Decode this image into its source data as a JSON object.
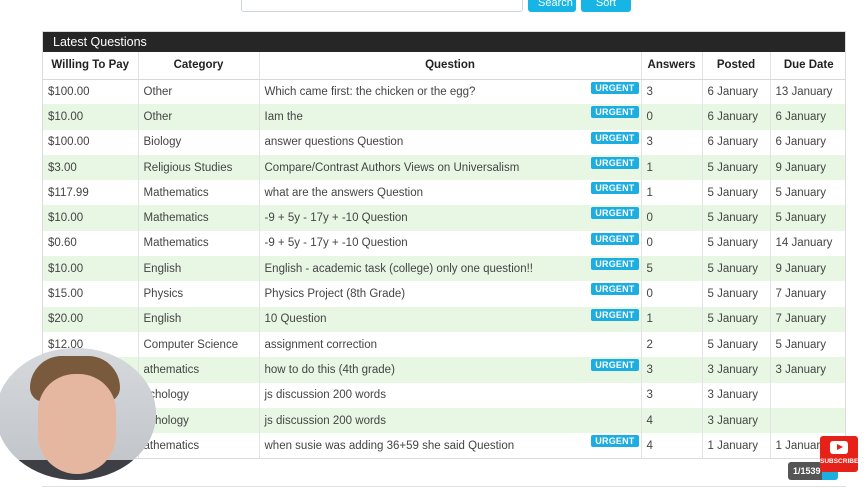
{
  "toolbar": {
    "search_label": "Search",
    "sort_label": "Sort by"
  },
  "panel": {
    "title": "Latest Questions"
  },
  "columns": [
    "Willing To Pay",
    "Category",
    "Question",
    "Answers",
    "Posted",
    "Due Date"
  ],
  "badge_text": "URGENT",
  "rows": [
    {
      "pay": "$100.00",
      "category": "Other",
      "question": "Which came first: the chicken or the egg?",
      "urgent": true,
      "answers": "3",
      "posted": "6 January",
      "due": "13 January"
    },
    {
      "pay": "$10.00",
      "category": "Other",
      "question": "Iam the",
      "urgent": true,
      "answers": "0",
      "posted": "6 January",
      "due": "6 January"
    },
    {
      "pay": "$100.00",
      "category": "Biology",
      "question": "answer questions Question",
      "urgent": true,
      "answers": "3",
      "posted": "6 January",
      "due": "6 January"
    },
    {
      "pay": "$3.00",
      "category": "Religious Studies",
      "question": "Compare/Contrast Authors Views on Universalism",
      "urgent": true,
      "answers": "1",
      "posted": "5 January",
      "due": "9 January"
    },
    {
      "pay": "$117.99",
      "category": "Mathematics",
      "question": "what are the answers Question",
      "urgent": true,
      "answers": "1",
      "posted": "5 January",
      "due": "5 January"
    },
    {
      "pay": "$10.00",
      "category": "Mathematics",
      "question": "-9 + 5y - 17y + -10 Question",
      "urgent": true,
      "answers": "0",
      "posted": "5 January",
      "due": "5 January"
    },
    {
      "pay": "$0.60",
      "category": "Mathematics",
      "question": "-9 + 5y - 17y + -10 Question",
      "urgent": true,
      "answers": "0",
      "posted": "5 January",
      "due": "14 January"
    },
    {
      "pay": "$10.00",
      "category": "English",
      "question": "English - academic task (college) only one question!!",
      "urgent": true,
      "answers": "5",
      "posted": "5 January",
      "due": "9 January"
    },
    {
      "pay": "$15.00",
      "category": "Physics",
      "question": "Physics Project (8th Grade)",
      "urgent": true,
      "answers": "0",
      "posted": "5 January",
      "due": "7 January"
    },
    {
      "pay": "$20.00",
      "category": "English",
      "question": "10 Question",
      "urgent": true,
      "answers": "1",
      "posted": "5 January",
      "due": "7 January"
    },
    {
      "pay": "$12.00",
      "category": "Computer Science",
      "question": "assignment correction",
      "urgent": false,
      "answers": "2",
      "posted": "5 January",
      "due": "5 January"
    },
    {
      "pay": "",
      "category": "athematics",
      "question": "how to do this (4th grade)",
      "urgent": true,
      "answers": "3",
      "posted": "3 January",
      "due": "3 January"
    },
    {
      "pay": "",
      "category": "ychology",
      "question": "js discussion 200 words",
      "urgent": false,
      "answers": "3",
      "posted": "3 January",
      "due": ""
    },
    {
      "pay": "",
      "category": "ychology",
      "question": "js discussion 200 words",
      "urgent": false,
      "answers": "4",
      "posted": "3 January",
      "due": ""
    },
    {
      "pay": "",
      "category": "athematics",
      "question": "when susie was adding 36+59 she said Question",
      "urgent": true,
      "answers": "4",
      "posted": "1 January",
      "due": "1 January"
    }
  ],
  "pager": {
    "label": "1/1539"
  },
  "overlay": {
    "subscribe_label": "SUBSCRIBE"
  },
  "colors": {
    "accent": "#1caee0",
    "header_bg": "#262626",
    "stripe": "#e8f7e4"
  }
}
